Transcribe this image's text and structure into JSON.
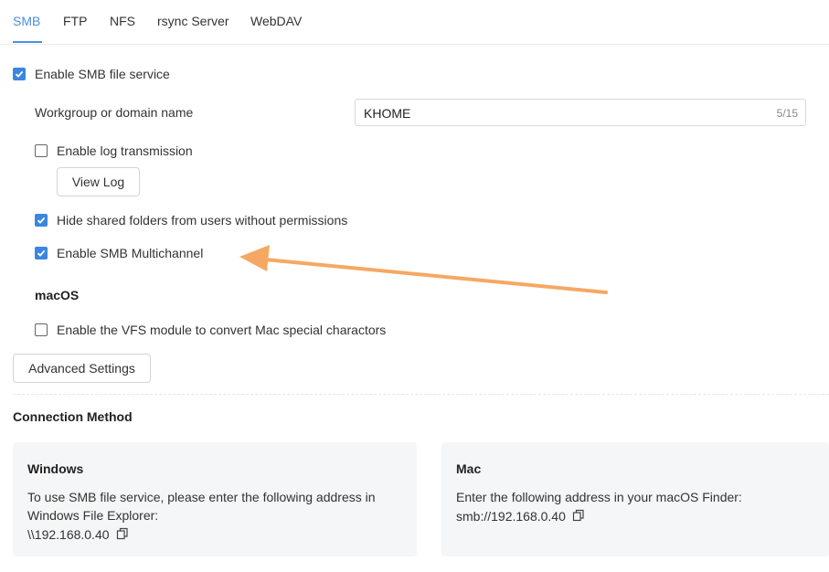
{
  "tabs": [
    {
      "label": "SMB",
      "active": true
    },
    {
      "label": "FTP",
      "active": false
    },
    {
      "label": "NFS",
      "active": false
    },
    {
      "label": "rsync Server",
      "active": false
    },
    {
      "label": "WebDAV",
      "active": false
    }
  ],
  "settings": {
    "enable_smb": {
      "label": "Enable SMB file service",
      "checked": true
    },
    "workgroup": {
      "label": "Workgroup or domain name",
      "value": "KHOME",
      "counter": "5/15"
    },
    "log_transmission": {
      "label": "Enable log transmission",
      "checked": false
    },
    "view_log_label": "View Log",
    "hide_shared": {
      "label": "Hide shared folders from users without permissions",
      "checked": true
    },
    "multichannel": {
      "label": "Enable SMB Multichannel",
      "checked": true
    },
    "macos_heading": "macOS",
    "vfs": {
      "label": "Enable the VFS module to convert Mac special charactors",
      "checked": false
    },
    "advanced_label": "Advanced Settings"
  },
  "connection": {
    "heading": "Connection Method",
    "windows": {
      "title": "Windows",
      "text_line1": "To use SMB file service, please enter the following address in",
      "text_line2": "Windows File Explorer:",
      "address": "\\\\192.168.0.40"
    },
    "mac": {
      "title": "Mac",
      "text": "Enter the following address in your macOS Finder:",
      "address": "smb://192.168.0.40"
    }
  },
  "colors": {
    "accent": "#4a8fe0",
    "checkbox": "#3a86e0",
    "annotation_arrow": "#f5a864",
    "card_bg": "#f5f6f7"
  },
  "icons": [
    "check-icon",
    "copy-icon",
    "annotation-arrow"
  ]
}
